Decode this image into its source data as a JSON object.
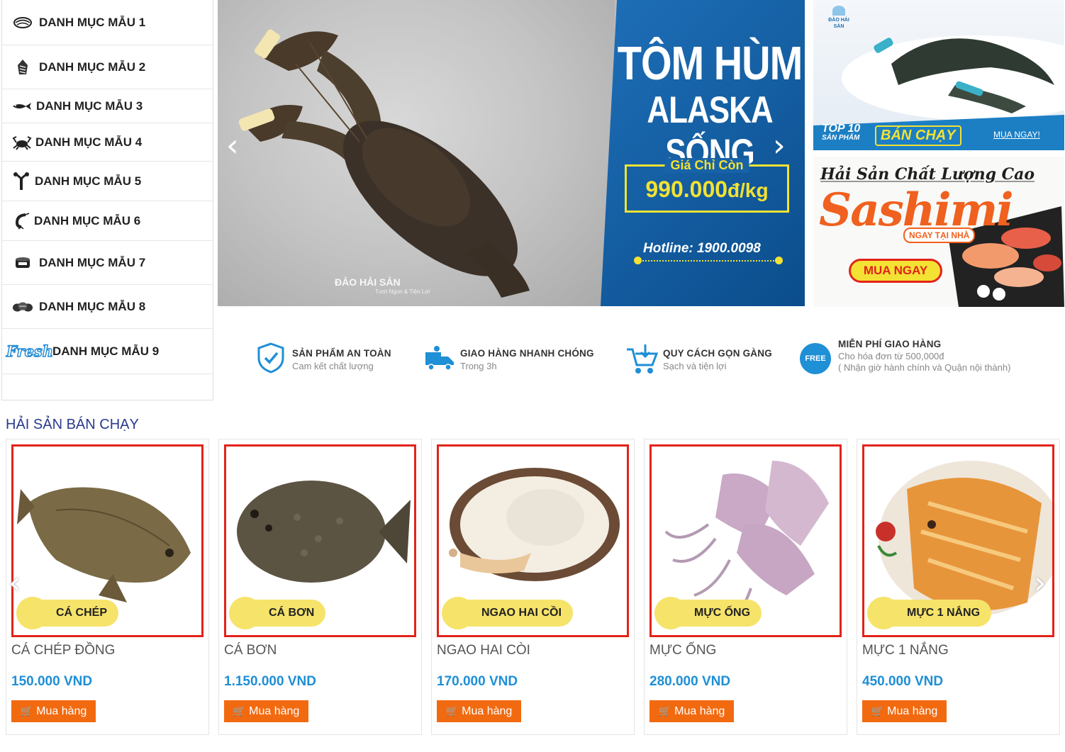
{
  "categories": [
    {
      "label": "DANH MỤC MẪU 1",
      "icon": "oyster-icon"
    },
    {
      "label": "DANH MỤC MẪU 2",
      "icon": "shell-icon"
    },
    {
      "label": "DANH MỤC MẪU 3",
      "icon": "fish-icon"
    },
    {
      "label": "DANH MỤC MẪU 4",
      "icon": "crab-icon"
    },
    {
      "label": "DANH MỤC MẪU 5",
      "icon": "lobster-icon"
    },
    {
      "label": "DANH MỤC MẪU 6",
      "icon": "shrimp-icon"
    },
    {
      "label": "DANH MỤC MẪU 7",
      "icon": "can-icon"
    },
    {
      "label": "DANH MỤC MẪU 8",
      "icon": "clams-icon"
    },
    {
      "label": "DANH MỤC MẪU 9",
      "icon": "fresh-icon"
    }
  ],
  "fresh_icon_text": "Fresh",
  "slider": {
    "title_line1": "TÔM HÙM",
    "title_line2": "ALASKA SỐNG",
    "price_caption": "Giá Chỉ Còn",
    "price": "990.000",
    "price_unit": "đ/kg",
    "hotline": "Hotline: 1900.0098",
    "watermark": "ĐẢO HẢI SẢN",
    "watermark_sub": "Tươi Ngon & Tiện Lợi",
    "prev_arrow": "‹",
    "next_arrow": "›"
  },
  "banner1": {
    "brand": "ĐẢO HẢI SẢN",
    "top_line1": "TOP 10",
    "top_line2": "SẢN PHẨM",
    "bestseller": "BÁN CHẠY",
    "cta": "MUA NGAY!"
  },
  "banner2": {
    "headline": "Hải Sản Chất Lượng Cao",
    "product": "Sashimi",
    "subline": "NGAY TẠI NHÀ",
    "cta": "MUA NGAY"
  },
  "features": [
    {
      "title": "SẢN PHẨM AN TOÀN",
      "sub": "Cam kết chất lượng",
      "icon": "shield-check-icon"
    },
    {
      "title": "GIAO HÀNG NHANH CHÓNG",
      "sub": "Trong 3h",
      "icon": "delivery-truck-icon"
    },
    {
      "title": "QUY CÁCH GỌN GÀNG",
      "sub": "Sạch và tiện lợi",
      "icon": "shopping-cart-icon"
    },
    {
      "title": "MIỄN PHÍ GIAO HÀNG",
      "sub": "Cho hóa đơn từ 500,000đ",
      "sub2": "( Nhận giờ hành chính và Quận nội thành)",
      "icon": "free-badge-icon",
      "badge": "FREE"
    }
  ],
  "section_title": "HẢI SẢN BÁN CHẠY",
  "products": [
    {
      "tag": "CÁ CHÉP",
      "name": "CÁ CHÉP ĐỒNG",
      "price": "150.000 VND",
      "buy": "Mua hàng"
    },
    {
      "tag": "CÁ BƠN",
      "name": "CÁ BƠN",
      "price": "1.150.000 VND",
      "buy": "Mua hàng"
    },
    {
      "tag": "NGAO HAI CỒI",
      "name": "NGAO HAI CÒI",
      "price": "170.000 VND",
      "buy": "Mua hàng"
    },
    {
      "tag": "MỰC ỐNG",
      "name": "MỰC ỐNG",
      "price": "280.000 VND",
      "buy": "Mua hàng"
    },
    {
      "tag": "MỰC 1 NẮNG",
      "name": "MỰC 1 NẮNG",
      "price": "450.000 VND",
      "buy": "Mua hàng"
    }
  ],
  "colors": {
    "accent_blue": "#1e8fd6",
    "buy_orange": "#f26a10",
    "title_navy": "#2b3a8c",
    "frame_red": "#e2231a",
    "banner_blue": "#0b4d8c",
    "price_yellow": "#f3e233"
  }
}
